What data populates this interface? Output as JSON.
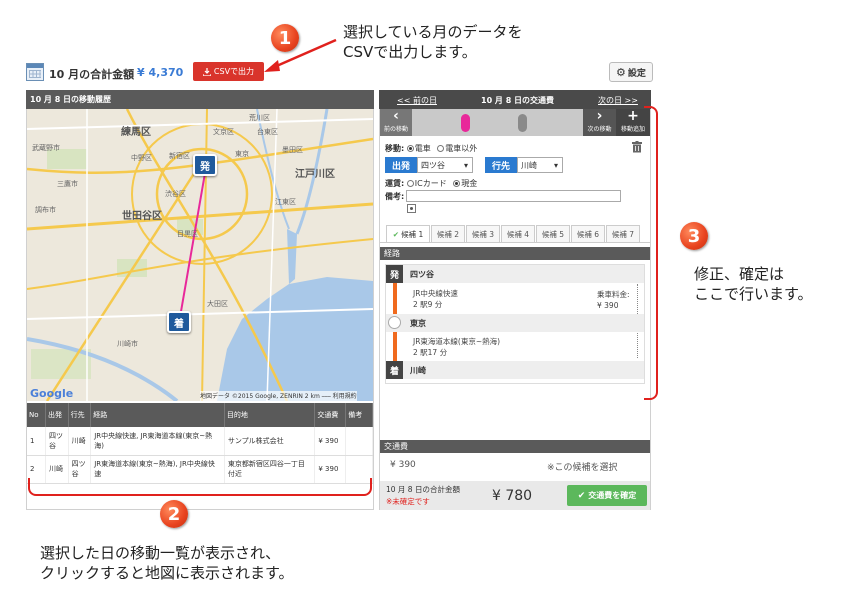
{
  "header": {
    "total_title": "10 月の合計金額",
    "total_amount": "¥ 4,370",
    "csv_button": "CSVで出力",
    "settings_button": "設定"
  },
  "callouts": {
    "c1_num": "1",
    "c1_line1": "選択している月のデータを",
    "c1_line2": "CSVで出力します。",
    "c2_num": "2",
    "c2_line1": "選択した日の移動一覧が表示され、",
    "c2_line2": "クリックすると地図に表示されます。",
    "c3_num": "3",
    "c3_line1": "修正、確定は",
    "c3_line2": "ここで行います。"
  },
  "map": {
    "title": "10 月 8 日の移動履歴",
    "labels": {
      "nerima": "練馬区",
      "setagaya": "世田谷区",
      "edogawa": "江戸川区",
      "musashino": "武蔵野市",
      "mitaka": "三鷹市",
      "chofu": "調布市",
      "nakano": "中野区",
      "shinjuku": "新宿区",
      "tokyo": "東京",
      "bunkyo": "文京区",
      "taito": "台東区",
      "sumida": "墨田区",
      "koto": "江東区",
      "arakawa": "荒川区",
      "shibuya": "渋谷区",
      "meguro": "目黒区",
      "ota": "大田区",
      "kawasaki": "川崎市"
    },
    "marker_start": "発",
    "marker_end": "着",
    "google": "Google",
    "copyright": "地図データ ©2015 Google, ZENRIN   2 km ⎯⎯⎯   利用規約"
  },
  "table": {
    "headers": [
      "No",
      "出発",
      "行先",
      "経路",
      "目的地",
      "交通費",
      "備考"
    ],
    "rows": [
      [
        "1",
        "四ツ谷",
        "川崎",
        "JR中央線快速, JR東海道本線(東京~熱海)",
        "サンプル株式会社",
        "¥ 390",
        ""
      ],
      [
        "2",
        "川崎",
        "四ツ谷",
        "JR東海道本線(東京~熱海), JR中央線快速",
        "東京都新宿区四谷一丁目付近",
        "¥ 390",
        ""
      ]
    ]
  },
  "panel": {
    "prev_day": "<< 前の日",
    "title": "10 月 8 日の交通費",
    "next_day": "次の日 >>",
    "prev_trip": "前の移動",
    "next_trip": "次の移動",
    "add_trip": "移動追加",
    "move_label": "移動:",
    "move_opt1": "電車",
    "move_opt2": "電車以外",
    "dep_tag": "出発",
    "dep_value": "四ツ谷",
    "dest_tag": "行先",
    "dest_value": "川崎",
    "fare_label": "運賃:",
    "fare_opt1": "ICカード",
    "fare_opt2": "現金",
    "note_label": "備考:",
    "tabs": [
      "候補 1",
      "候補 2",
      "候補 3",
      "候補 4",
      "候補 5",
      "候補 6",
      "候補 7"
    ],
    "route_header": "経路",
    "dep_badge": "発",
    "arr_badge": "着",
    "st1": "四ツ谷",
    "line1": "JR中央線快速",
    "line1_info": "2 駅9 分",
    "fare_caption": "乗車料金:",
    "fare_value": "¥ 390",
    "st2": "東京",
    "line2": "JR東海道本線(東京~熱海)",
    "line2_info": "2 駅17 分",
    "st3": "川崎",
    "fare_header": "交通費",
    "fare_amount": "¥ 390",
    "select_hint": "※この候補を選択",
    "day_total_label": "10 月 8 日の合計金額",
    "unconfirmed": "※未確定です",
    "day_total": "¥ 780",
    "confirm_button": "交通費を確定"
  },
  "colors": {
    "csv_red": "#d9342b",
    "accent_blue": "#2a7ad0",
    "route_pink": "#e8289a",
    "line_orange": "#f06a1e",
    "confirm_green": "#5cb85c",
    "callout_red": "#e0211d"
  }
}
